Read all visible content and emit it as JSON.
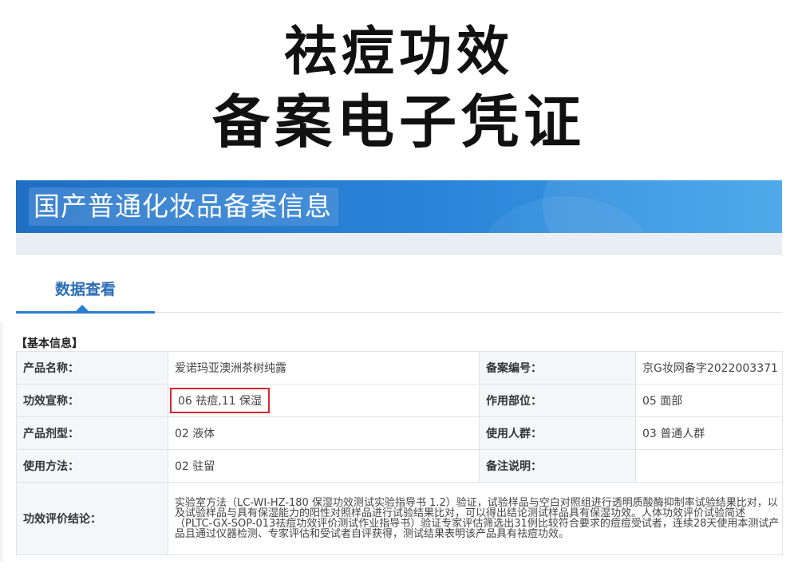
{
  "hero": {
    "line1": "祛痘功效",
    "line2": "备案电子凭证"
  },
  "banner": {
    "title": "国产普通化妆品备案信息"
  },
  "tab": {
    "label": "数据查看"
  },
  "section": {
    "title": "【基本信息】"
  },
  "fields": {
    "product_name_label": "产品名称：",
    "product_name": "爱诺玛亚澳洲茶树纯露",
    "record_no_label": "备案编号：",
    "record_no": "京G妆网备字2022003371",
    "efficacy_label": "功效宣称：",
    "efficacy": "06 祛痘,11 保湿",
    "site_label": "作用部位：",
    "site": "05 面部",
    "form_label": "产品剂型：",
    "form": "02 液体",
    "users_label": "使用人群：",
    "users": "03 普通人群",
    "usage_label": "使用方法：",
    "usage": "02 驻留",
    "remarks_label": "备注说明：",
    "remarks": "",
    "conclusion_label": "功效评价结论：",
    "conclusion": "实验室方法（LC-WI-HZ-180 保湿功效测试实验指导书 1.2）验证，试验样品与空白对照组进行透明质酸酶抑制率试验结果比对，以及试验样品与具有保湿能力的阳性对照样品进行试验结果比对，可以得出结论测试样品具有保湿功效。人体功效评价试验简述（PLTC-GX-SOP-013祛痘功效评价测试作业指导书）验证专家评估筛选出31例比较符合要求的痘痘受试者，连续28天使用本测试产品且通过仪器检测、专家评估和受试者自评获得，测试结果表明该产品具有祛痘功效。"
  },
  "colors": {
    "banner_blue": "#2a84d8",
    "tab_blue": "#2a6db4",
    "highlight_red": "#d8272d"
  }
}
